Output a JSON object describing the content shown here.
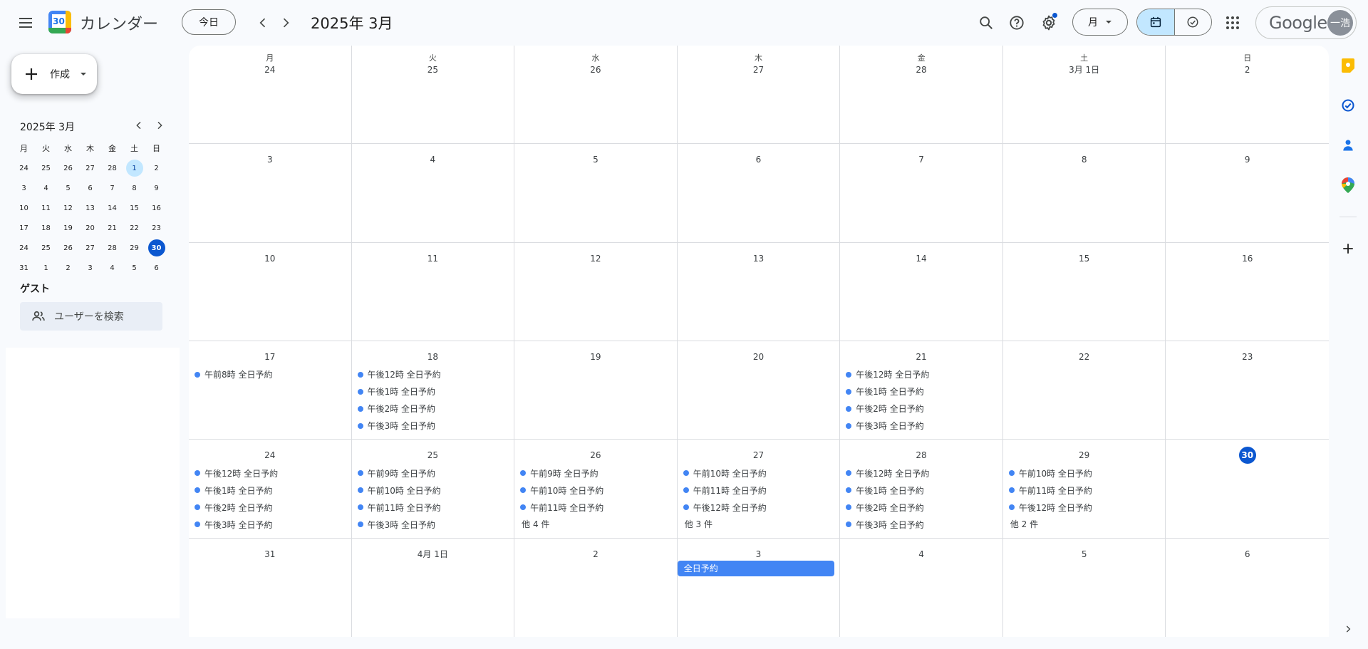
{
  "header": {
    "app_title": "カレンダー",
    "logo_text": "30",
    "today_label": "今日",
    "period_title": "2025年 3月",
    "view_select_label": "月",
    "google_label": "Google",
    "avatar_text": "一浩"
  },
  "sidebar": {
    "create_label": "作成",
    "mini_calendar": {
      "title": "2025年 3月",
      "weekday_headers": [
        "月",
        "火",
        "水",
        "木",
        "金",
        "土",
        "日"
      ],
      "days": [
        "24",
        "25",
        "26",
        "27",
        "28",
        "1",
        "2",
        "3",
        "4",
        "5",
        "6",
        "7",
        "8",
        "9",
        "10",
        "11",
        "12",
        "13",
        "14",
        "15",
        "16",
        "17",
        "18",
        "19",
        "20",
        "21",
        "22",
        "23",
        "24",
        "25",
        "26",
        "27",
        "28",
        "29",
        "30",
        "31",
        "1",
        "2",
        "3",
        "4",
        "5",
        "6"
      ],
      "selected_day": "1",
      "today_day": "30"
    },
    "guest_label": "ゲスト",
    "guest_search_placeholder": "ユーザーを検索"
  },
  "calendar": {
    "weekday_headers": [
      "月",
      "火",
      "水",
      "木",
      "金",
      "土",
      "日"
    ],
    "cells": [
      {
        "date": "24",
        "events": []
      },
      {
        "date": "25",
        "events": []
      },
      {
        "date": "26",
        "events": []
      },
      {
        "date": "27",
        "events": []
      },
      {
        "date": "28",
        "events": []
      },
      {
        "date": "3月 1日",
        "events": []
      },
      {
        "date": "2",
        "events": []
      },
      {
        "date": "3",
        "events": []
      },
      {
        "date": "4",
        "events": []
      },
      {
        "date": "5",
        "events": []
      },
      {
        "date": "6",
        "events": []
      },
      {
        "date": "7",
        "events": []
      },
      {
        "date": "8",
        "events": []
      },
      {
        "date": "9",
        "events": []
      },
      {
        "date": "10",
        "events": []
      },
      {
        "date": "11",
        "events": []
      },
      {
        "date": "12",
        "events": []
      },
      {
        "date": "13",
        "events": []
      },
      {
        "date": "14",
        "events": []
      },
      {
        "date": "15",
        "events": []
      },
      {
        "date": "16",
        "events": []
      },
      {
        "date": "17",
        "events": [
          "午前8時 全日予約"
        ]
      },
      {
        "date": "18",
        "events": [
          "午後12時 全日予約",
          "午後1時 全日予約",
          "午後2時 全日予約",
          "午後3時 全日予約"
        ]
      },
      {
        "date": "19",
        "events": []
      },
      {
        "date": "20",
        "events": []
      },
      {
        "date": "21",
        "events": [
          "午後12時 全日予約",
          "午後1時 全日予約",
          "午後2時 全日予約",
          "午後3時 全日予約"
        ]
      },
      {
        "date": "22",
        "events": []
      },
      {
        "date": "23",
        "events": []
      },
      {
        "date": "24",
        "events": [
          "午後12時 全日予約",
          "午後1時 全日予約",
          "午後2時 全日予約",
          "午後3時 全日予約"
        ]
      },
      {
        "date": "25",
        "events": [
          "午前9時 全日予約",
          "午前10時 全日予約",
          "午前11時 全日予約",
          "午後3時 全日予約"
        ]
      },
      {
        "date": "26",
        "events": [
          "午前9時 全日予約",
          "午前10時 全日予約",
          "午前11時 全日予約"
        ],
        "more": "他 4 件"
      },
      {
        "date": "27",
        "events": [
          "午前10時 全日予約",
          "午前11時 全日予約",
          "午後12時 全日予約"
        ],
        "more": "他 3 件"
      },
      {
        "date": "28",
        "events": [
          "午後12時 全日予約",
          "午後1時 全日予約",
          "午後2時 全日予約",
          "午後3時 全日予約"
        ]
      },
      {
        "date": "29",
        "events": [
          "午前10時 全日予約",
          "午前11時 全日予約",
          "午後12時 全日予約"
        ],
        "more": "他 2 件"
      },
      {
        "date": "30",
        "events": [],
        "today": true
      },
      {
        "date": "31",
        "events": []
      },
      {
        "date": "4月 1日",
        "events": []
      },
      {
        "date": "2",
        "events": []
      },
      {
        "date": "3",
        "events": [],
        "allday": "全日予約"
      },
      {
        "date": "4",
        "events": []
      },
      {
        "date": "5",
        "events": []
      },
      {
        "date": "6",
        "events": []
      }
    ]
  },
  "colors": {
    "accent": "#0b57d0",
    "event_dot": "#4285f4",
    "selected_bg": "#c2e7ff"
  },
  "right_rail": {
    "icons": [
      "keep-icon",
      "tasks-icon",
      "contacts-icon",
      "maps-icon",
      "add-icon",
      "expand-icon"
    ]
  }
}
